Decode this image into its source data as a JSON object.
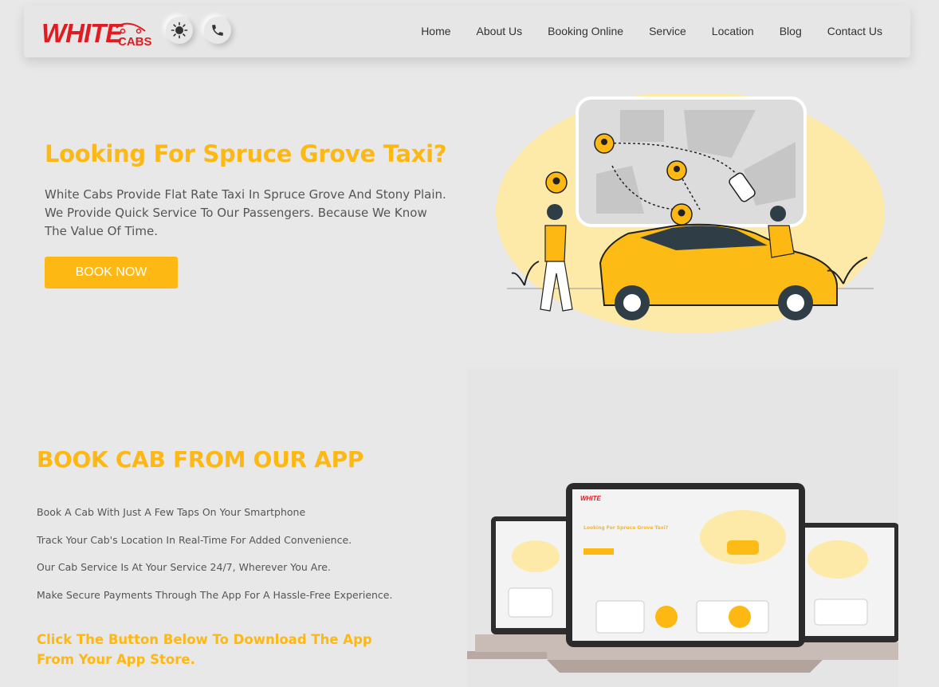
{
  "brand": {
    "logo_word": "WHITE",
    "logo_sub": "CABS",
    "colors": {
      "primary": "#fdb813",
      "logo_red": "#e11b22",
      "text": "#555555",
      "nav_text": "#333333"
    }
  },
  "header": {
    "theme_icon": "sun-icon",
    "phone_icon": "phone-icon",
    "nav": [
      {
        "label": "Home"
      },
      {
        "label": "About Us"
      },
      {
        "label": "Booking Online"
      },
      {
        "label": "Service"
      },
      {
        "label": "Location"
      },
      {
        "label": "Blog"
      },
      {
        "label": "Contact Us"
      }
    ]
  },
  "hero": {
    "title": "Looking For Spruce Grove Taxi?",
    "description": "White Cabs Provide Flat Rate Taxi In Spruce Grove And Stony Plain. We Provide Quick Service To Our Passengers. Because We Know The Value Of Time.",
    "cta": "BOOK NOW"
  },
  "app_section": {
    "title": "BOOK CAB FROM OUR APP",
    "features": [
      "Book A Cab With Just A Few Taps On Your Smartphone",
      "Track Your Cab's Location In Real-Time For Added Convenience.",
      "Our Cab Service Is At Your Service 24/7, Wherever You Are.",
      "Make Secure Payments Through The App For A Hassle-Free Experience."
    ],
    "cta_text": "Click The Button Below To Download The App From Your App Store."
  }
}
